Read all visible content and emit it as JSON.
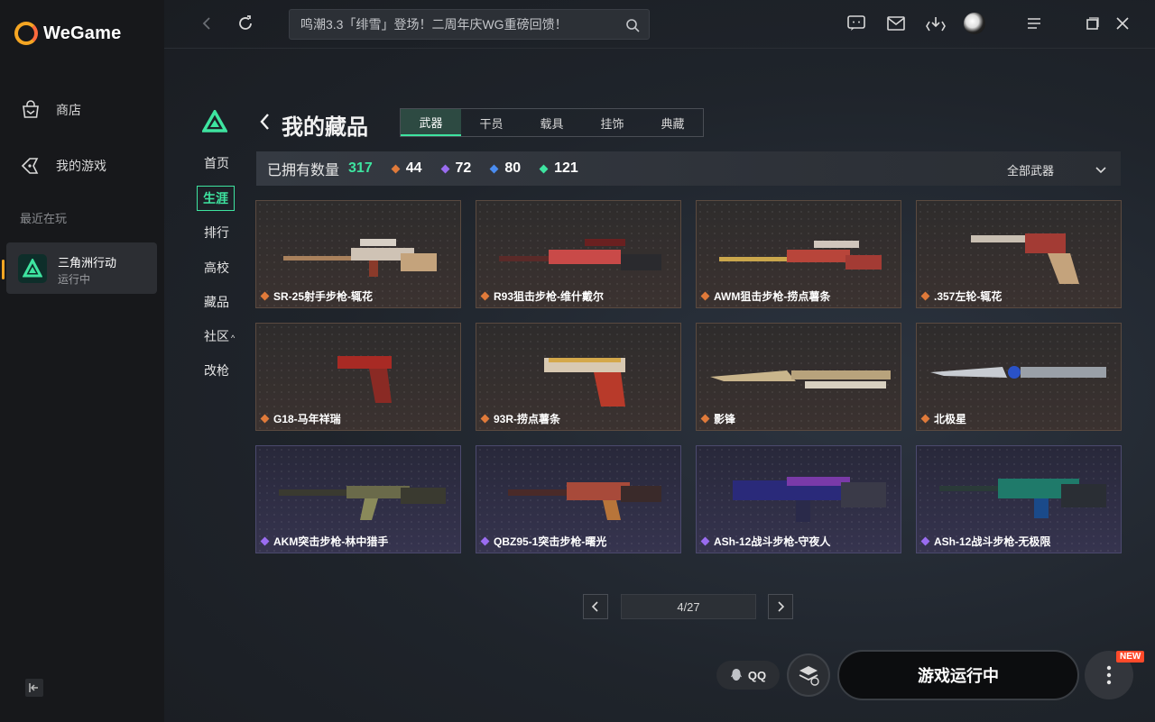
{
  "app": {
    "name": "WeGame"
  },
  "sidebar": {
    "items": [
      {
        "label": "商店",
        "icon": "store-bag-icon"
      },
      {
        "label": "我的游戏",
        "icon": "my-games-icon"
      }
    ],
    "recent_title": "最近在玩",
    "recent_game": {
      "name": "三角洲行动",
      "status": "运行中"
    }
  },
  "topbar": {
    "search_text": "鸣潮3.3「绯雪」登场！二周年庆WG重磅回馈！"
  },
  "game_nav": {
    "items": [
      {
        "label": "首页",
        "active": false
      },
      {
        "label": "生涯",
        "active": true
      },
      {
        "label": "排行",
        "active": false
      },
      {
        "label": "高校",
        "active": false
      },
      {
        "label": "藏品",
        "active": false
      },
      {
        "label": "社区",
        "active": false,
        "caret": "^"
      },
      {
        "label": "改枪",
        "active": false
      }
    ]
  },
  "page": {
    "title": "我的藏品",
    "tabs": [
      "武器",
      "干员",
      "载具",
      "挂饰",
      "典藏"
    ],
    "active_tab": "武器"
  },
  "stats": {
    "label": "已拥有数量",
    "total": "317",
    "counts": [
      {
        "value": "44",
        "color": "#e07a3a"
      },
      {
        "value": "72",
        "color": "#9a6cf0"
      },
      {
        "value": "80",
        "color": "#4a8cf0"
      },
      {
        "value": "121",
        "color": "#3ee4a0"
      }
    ],
    "filter": "全部武器"
  },
  "items": [
    {
      "name": "SR-25射手步枪-辄花",
      "rarity": "orange"
    },
    {
      "name": "R93狙击步枪-维什戴尔",
      "rarity": "orange"
    },
    {
      "name": "AWM狙击步枪-捞点薯条",
      "rarity": "orange"
    },
    {
      "name": ".357左轮-辄花",
      "rarity": "orange"
    },
    {
      "name": "G18-马年祥瑞",
      "rarity": "orange"
    },
    {
      "name": "93R-捞点薯条",
      "rarity": "orange"
    },
    {
      "name": "影锋",
      "rarity": "orange"
    },
    {
      "name": "北极星",
      "rarity": "orange"
    },
    {
      "name": "AKM突击步枪-林中猎手",
      "rarity": "purple"
    },
    {
      "name": "QBZ95-1突击步枪-曙光",
      "rarity": "purple"
    },
    {
      "name": "ASh-12战斗步枪-守夜人",
      "rarity": "purple"
    },
    {
      "name": "ASh-12战斗步枪-无极限",
      "rarity": "purple"
    }
  ],
  "pagination": {
    "text": "4/27"
  },
  "actions": {
    "qq_label": "QQ",
    "play_label": "游戏运行中",
    "new_badge": "NEW"
  },
  "colors": {
    "accent": "#3ee4a0",
    "orange_rarity": "#e07a3a",
    "purple_rarity": "#9a6cf0"
  }
}
